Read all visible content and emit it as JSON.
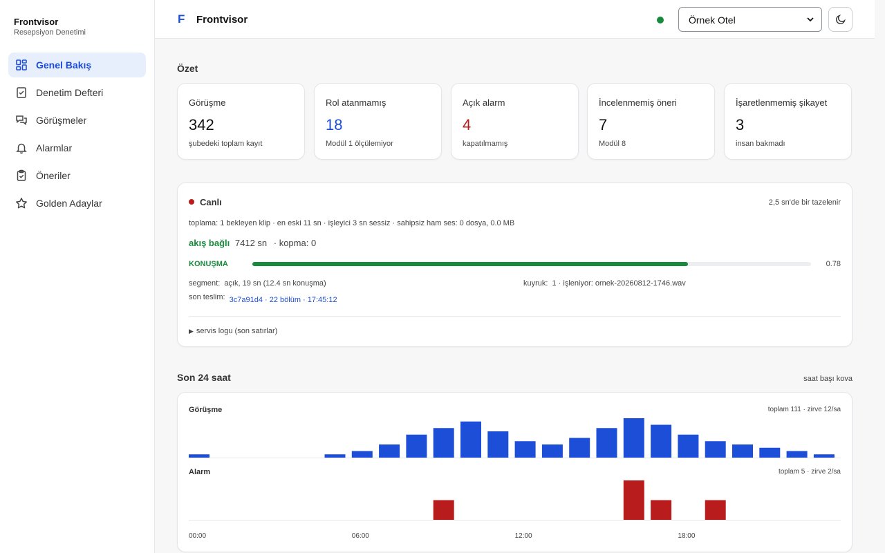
{
  "sidebar": {
    "brand": "Frontvisor",
    "subtitle": "Resepsiyon Denetimi",
    "items": [
      {
        "label": "Genel Bakış",
        "icon": "grid-icon",
        "active": true
      },
      {
        "label": "Denetim Defteri",
        "icon": "checklist-icon",
        "active": false
      },
      {
        "label": "Görüşmeler",
        "icon": "chat-icon",
        "active": false
      },
      {
        "label": "Alarmlar",
        "icon": "bell-icon",
        "active": false
      },
      {
        "label": "Öneriler",
        "icon": "clipboard-icon",
        "active": false
      },
      {
        "label": "Golden Adaylar",
        "icon": "star-icon",
        "active": false
      }
    ]
  },
  "header": {
    "logo_letter": "F",
    "title": "Frontvisor",
    "hotel": "Örnek Otel",
    "theme_icon": "moon-icon",
    "status_color": "#178a3c"
  },
  "summary": {
    "title": "Özet",
    "cards": [
      {
        "label": "Görüşme",
        "value": "342",
        "sub": "şubedeki toplam kayıt",
        "color": "#111111"
      },
      {
        "label": "Rol atanmamış",
        "value": "18",
        "sub": "Modül 1 ölçülemiyor",
        "color": "#1d4ed8"
      },
      {
        "label": "Açık alarm",
        "value": "4",
        "sub": "kapatılmamış",
        "color": "#b91c1c"
      },
      {
        "label": "İncelenmemiş öneri",
        "value": "7",
        "sub": "Modül 8",
        "color": "#111111"
      },
      {
        "label": "İşaretlenmemiş şikayet",
        "value": "3",
        "sub": "insan bakmadı",
        "color": "#111111"
      }
    ]
  },
  "live": {
    "title": "Canlı",
    "refresh": "2,5 sn'de bir tazelenir",
    "collect": "toplama: 1 bekleyen klip · en eski 11 sn · işleyici 3 sn sessiz · sahipsiz ham ses: 0 dosya, 0.0 MB",
    "flow_status": "akış bağlı",
    "flow_time": "7412 sn",
    "flow_drop": "· kopma: 0",
    "state_label": "KONUŞMA",
    "state_value": "0.78",
    "state_fraction": 0.78,
    "segment_label": "segment:",
    "segment_value": "açık, 19 sn (12.4 sn konuşma)",
    "queue_label": "kuyruk:",
    "queue_value": "1 · işleniyor: ornek-20260812-1746.wav",
    "delivery_label": "son teslim:",
    "delivery_value": "3c7a91d4 · 22 bölüm · 17:45:12",
    "log_toggle": "servis logu (son satırlar)"
  },
  "last24": {
    "title": "Son 24 saat",
    "bucket": "saat başı kova",
    "x_ticks": [
      "00:00",
      "06:00",
      "12:00",
      "18:00"
    ]
  },
  "chart_data": [
    {
      "type": "bar",
      "title": "Görüşme",
      "meta": "toplam 111 · zirve 12/sa",
      "color": "#1d4ed8",
      "x": [
        "00",
        "01",
        "02",
        "03",
        "04",
        "05",
        "06",
        "07",
        "08",
        "09",
        "10",
        "11",
        "12",
        "13",
        "14",
        "15",
        "16",
        "17",
        "18",
        "19",
        "20",
        "21",
        "22",
        "23"
      ],
      "values": [
        1,
        0,
        0,
        0,
        0,
        1,
        2,
        4,
        7,
        9,
        11,
        8,
        5,
        4,
        6,
        9,
        12,
        10,
        7,
        5,
        4,
        3,
        2,
        1
      ],
      "ylim": [
        0,
        12
      ]
    },
    {
      "type": "bar",
      "title": "Alarm",
      "meta": "toplam 5 · zirve 2/sa",
      "color": "#b91c1c",
      "x": [
        "00",
        "01",
        "02",
        "03",
        "04",
        "05",
        "06",
        "07",
        "08",
        "09",
        "10",
        "11",
        "12",
        "13",
        "14",
        "15",
        "16",
        "17",
        "18",
        "19",
        "20",
        "21",
        "22",
        "23"
      ],
      "values": [
        0,
        0,
        0,
        0,
        0,
        0,
        0,
        0,
        0,
        1,
        0,
        0,
        0,
        0,
        0,
        0,
        2,
        1,
        0,
        1,
        0,
        0,
        0,
        0
      ],
      "ylim": [
        0,
        2
      ]
    }
  ]
}
